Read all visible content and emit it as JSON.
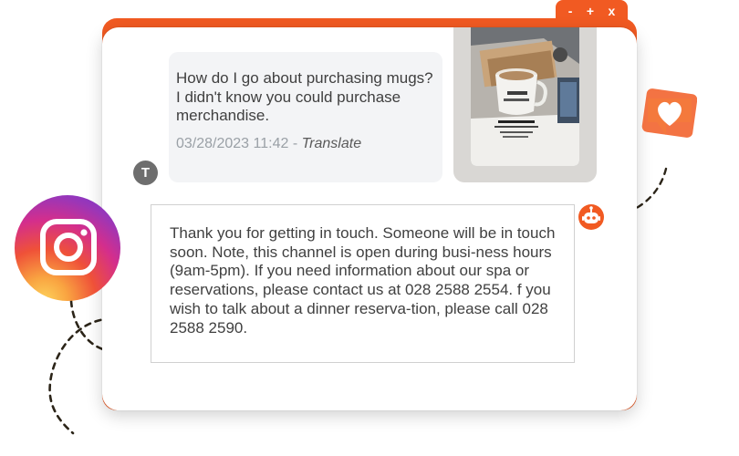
{
  "window": {
    "controls": {
      "minimize": "-",
      "maximize": "+",
      "close": "x"
    }
  },
  "conversation": {
    "user_message": {
      "avatar_initial": "T",
      "text": "How do I go about purchasing mugs? I didn't know you could purchase merchandise.",
      "timestamp": "03/28/2023 11:42",
      "separator": " - ",
      "translate_label": "Translate"
    },
    "attachment": {
      "type": "photo"
    },
    "bot_message": {
      "text": "Thank you for getting in touch. Someone will be in touch soon. Note, this channel is open during busi-ness hours (9am-5pm). If you need information about our spa or reservations, please contact us at 028 2588 2554. f you wish to talk about a dinner reserva-tion, please call 028 2588 2590."
    }
  },
  "icons": {
    "instagram": "instagram-icon",
    "heart": "heart-icon",
    "bot": "bot-icon"
  },
  "colors": {
    "accent": "#f15a22",
    "bubble_bg": "#f3f4f6",
    "text": "#404040",
    "meta": "#9aa0a6"
  }
}
